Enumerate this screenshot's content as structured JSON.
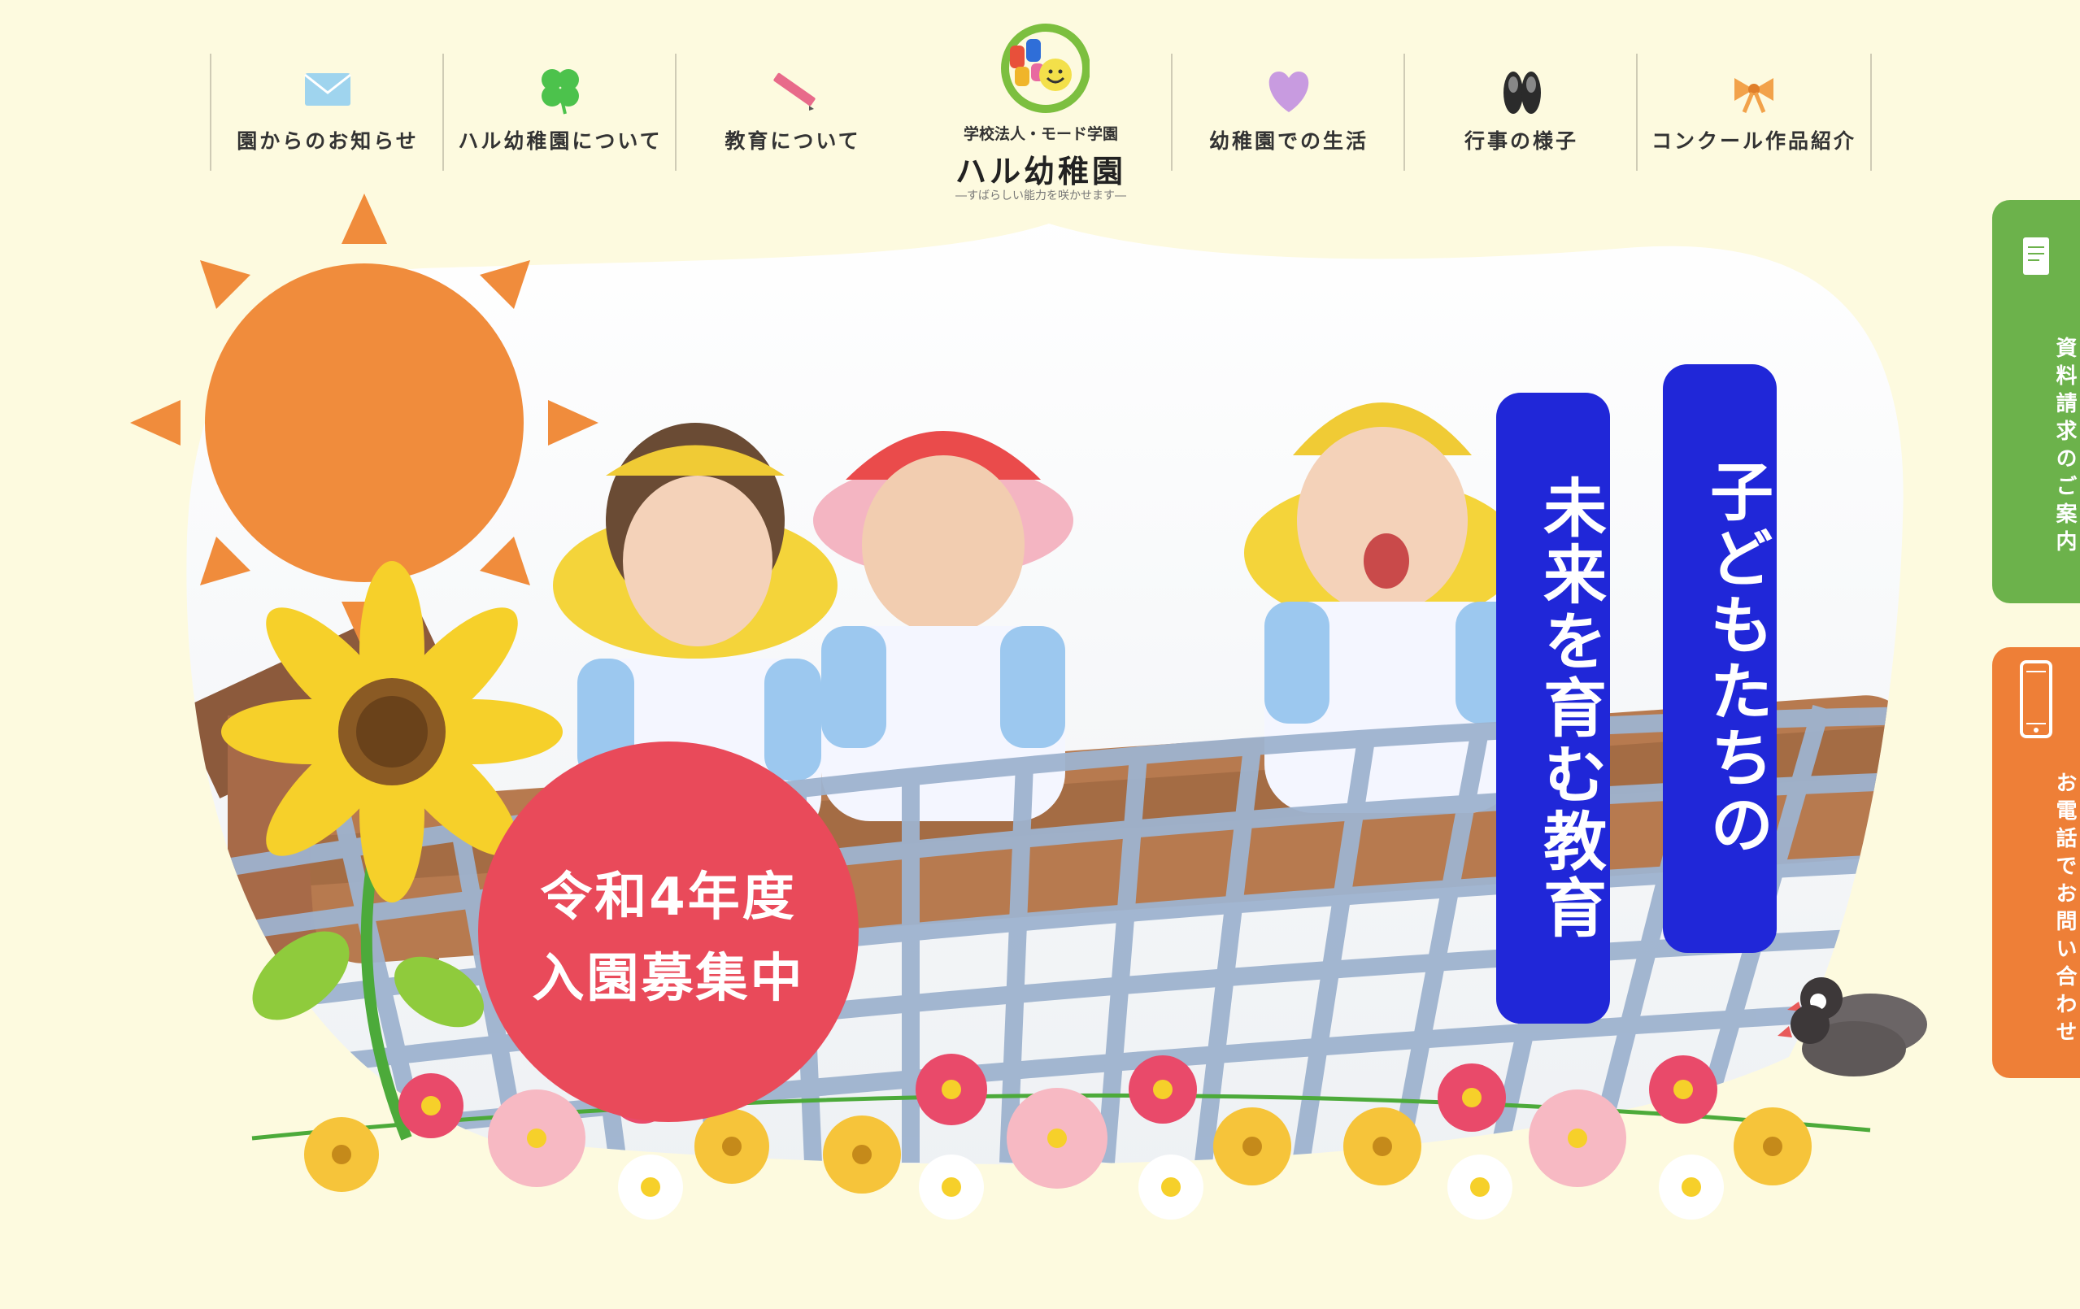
{
  "nav": {
    "items": [
      {
        "label": "園からのお知らせ",
        "icon": "envelope-icon"
      },
      {
        "label": "ハル幼稚園について",
        "icon": "clover-icon"
      },
      {
        "label": "教育について",
        "icon": "pencil-icon"
      },
      {
        "label": "幼稚園での生活",
        "icon": "heart-icon"
      },
      {
        "label": "行事の様子",
        "icon": "shoes-icon"
      },
      {
        "label": "コンクール作品紹介",
        "icon": "ribbon-icon"
      }
    ]
  },
  "logo": {
    "corporation": "学校法人・モード学園",
    "name": "ハル幼稚園",
    "tagline": "―すばらしい能力を咲かせます―"
  },
  "hero": {
    "title_line1": "子どもたちの",
    "title_line2": "未来を育む教育",
    "recruit_line1": "令和4年度",
    "recruit_line2": "入園募集中"
  },
  "side": {
    "brochure_label": "資料請求のご案内",
    "phone_label": "お電話でお問い合わせ"
  },
  "colors": {
    "background": "#fdfadf",
    "title_pill": "#2027d8",
    "recruit": "#e94a5a",
    "tab_green": "#6cb24b",
    "tab_orange": "#ee7f37",
    "sun": "#f08c3c"
  }
}
